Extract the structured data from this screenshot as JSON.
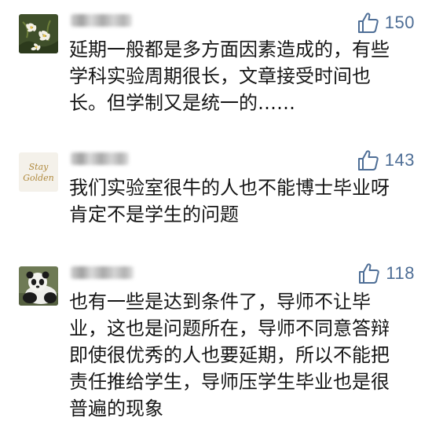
{
  "comments": [
    {
      "avatar": "flower-photo",
      "likes": "150",
      "lines": [
        "延期一般都是多方面因素造成的，有些",
        "学科实验周期很长，文章接受时间也",
        "长。但学制又是统一的……"
      ]
    },
    {
      "avatar": "stay-golden-logo",
      "avatar_text": "Stay Golden",
      "likes": "143",
      "lines": [
        "我们实验室很牛的人也不能博士毕业呀",
        "肯定不是学生的问题"
      ]
    },
    {
      "avatar": "panda-photo",
      "likes": "118",
      "lines": [
        "也有一些是达到条件了，导师不让毕",
        "业，这也是问题所在，导师不同意答辩",
        "即使很优秀的人也要延期，所以不能把",
        "责任推给学生，导师压学生毕业也是很",
        "普遍的现象"
      ]
    }
  ],
  "colors": {
    "like_blue": "#4e6e96",
    "text": "#161616"
  }
}
